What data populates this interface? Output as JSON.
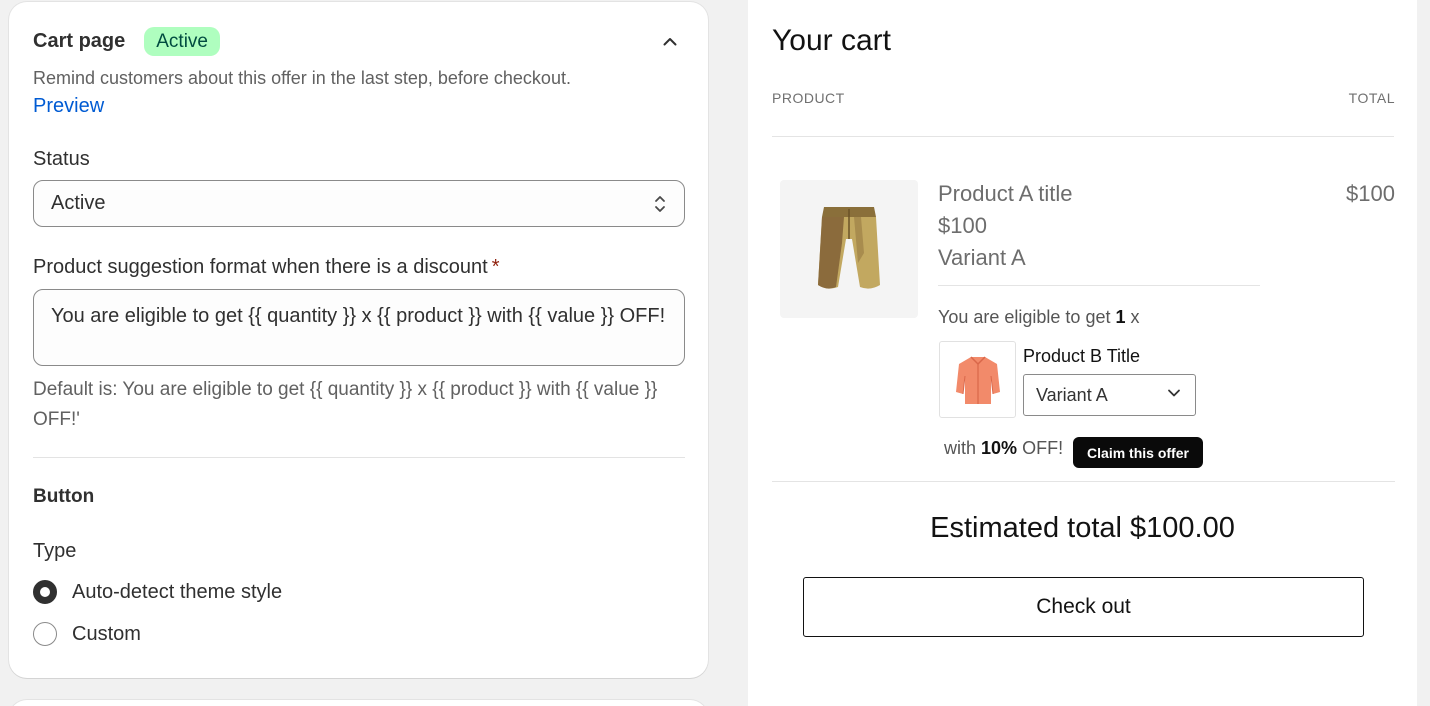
{
  "settings": {
    "title": "Cart page",
    "status_badge": "Active",
    "description": "Remind customers about this offer in the last step, before checkout.",
    "preview_link": "Preview",
    "status_label": "Status",
    "status_value": "Active",
    "format_label": "Product suggestion format when there is a discount",
    "required_mark": "*",
    "format_value": "You are eligible to get {{ quantity }} x {{ product }} with {{ value }} OFF!",
    "format_help": "Default is: You are eligible to get {{ quantity }} x {{ product }} with {{ value }} OFF!'",
    "button_section_title": "Button",
    "type_label": "Type",
    "type_options": [
      {
        "label": "Auto-detect theme style",
        "selected": true
      },
      {
        "label": "Custom",
        "selected": false
      }
    ]
  },
  "cart": {
    "title": "Your cart",
    "col_product": "PRODUCT",
    "col_total": "TOTAL",
    "item": {
      "title": "Product A title",
      "price": "$100",
      "variant": "Variant A",
      "total": "$100"
    },
    "offer": {
      "eligible_prefix": "You are eligible to get",
      "quantity": "1",
      "eligible_suffix": "x",
      "product_title": "Product B Title",
      "variant_selected": "Variant A",
      "with_prefix": "with",
      "discount": "10%",
      "with_suffix": "OFF!",
      "claim_label": "Claim this offer"
    },
    "estimated_total": "Estimated total $100.00",
    "checkout_label": "Check out"
  },
  "colors": {
    "badge_bg": "#affebf",
    "badge_text": "#014b40",
    "link": "#005bd3",
    "required": "#8e1f0b"
  }
}
